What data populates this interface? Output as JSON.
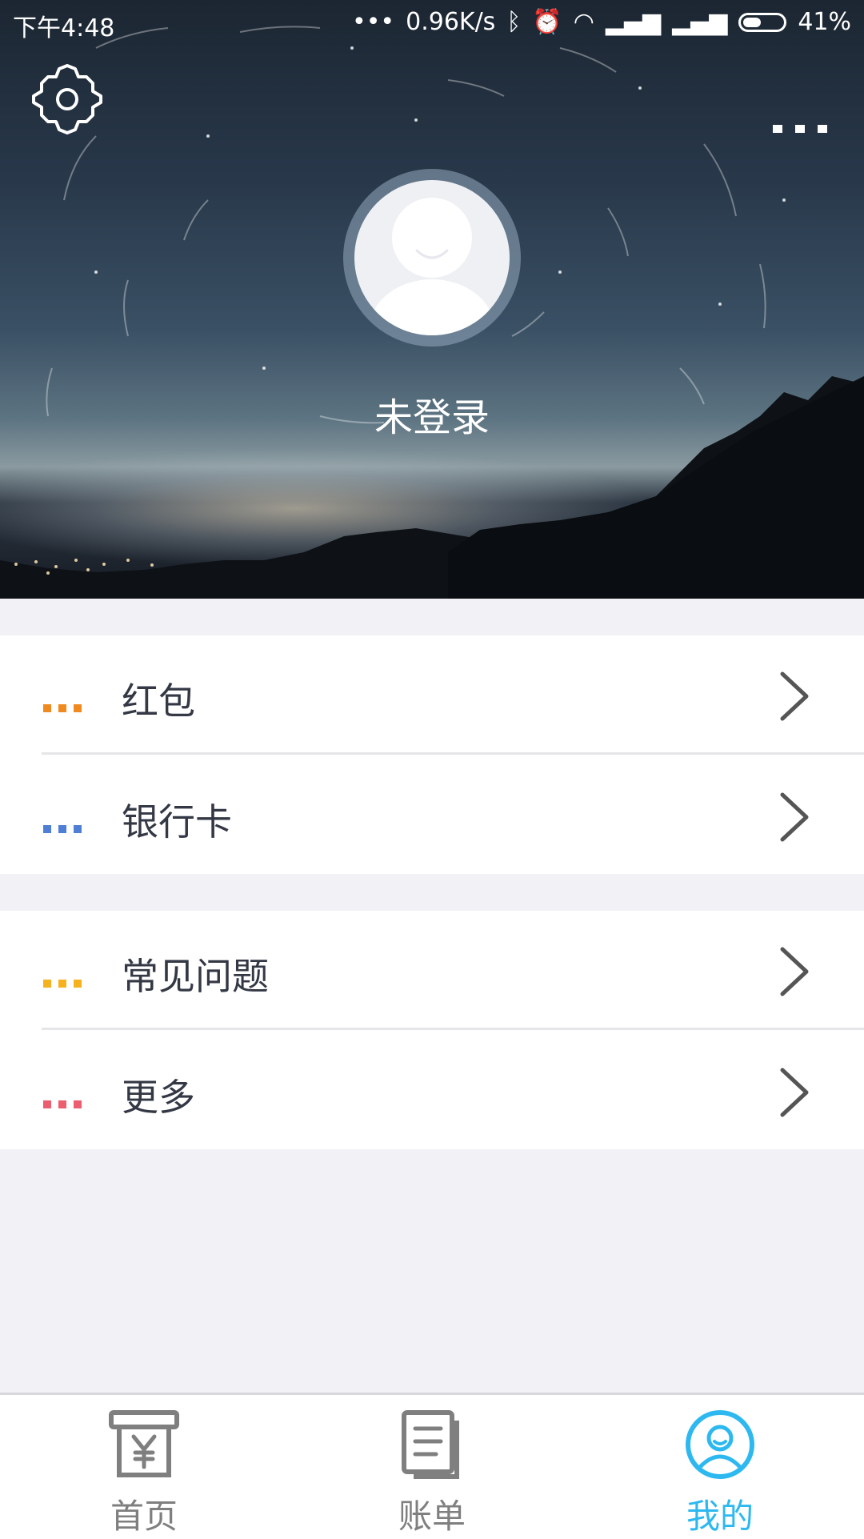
{
  "status_bar": {
    "time": "下午4:48",
    "network_speed": "0.96K/s",
    "battery": "41%"
  },
  "header": {
    "settings_icon": "gear-icon",
    "more_icon": "more-dots-icon",
    "login_status": "未登录"
  },
  "menu": {
    "groups": [
      {
        "items": [
          {
            "label": "红包",
            "accent": "#f08a1e"
          },
          {
            "label": "银行卡",
            "accent": "#4f7fd4"
          }
        ]
      },
      {
        "items": [
          {
            "label": "常见问题",
            "accent": "#f5b21e"
          },
          {
            "label": "更多",
            "accent": "#ec5d6f"
          }
        ]
      }
    ]
  },
  "tabbar": {
    "tabs": [
      {
        "label": "首页",
        "icon": "atm-yen-icon",
        "active": false
      },
      {
        "label": "账单",
        "icon": "bill-list-icon",
        "active": false
      },
      {
        "label": "我的",
        "icon": "user-profile-icon",
        "active": true
      }
    ],
    "active_color": "#2eb8f0",
    "inactive_color": "#7f7f7f"
  }
}
